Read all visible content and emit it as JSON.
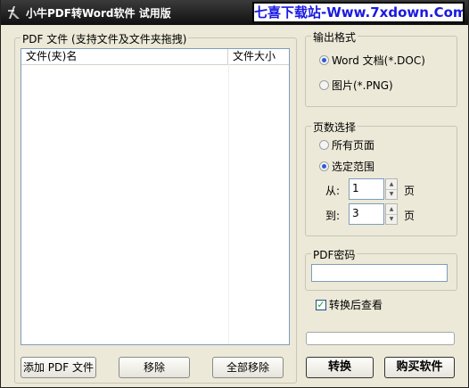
{
  "window": {
    "title": "小牛PDF转Word软件 试用版",
    "watermark": "七喜下载站-Www.7xdown.Com"
  },
  "file_group": {
    "label": "PDF 文件 (支持文件及文件夹拖拽)",
    "columns": [
      "文件(夹)名",
      "文件大小"
    ],
    "rows": []
  },
  "buttons": {
    "add_pdf": "添加 PDF 文件",
    "remove": "移除",
    "remove_all": "全部移除",
    "convert": "转换",
    "buy": "购买软件"
  },
  "output_format": {
    "label": "输出格式",
    "options": [
      "Word 文档(*.DOC)",
      "图片(*.PNG)"
    ],
    "selected": "Word 文档(*.DOC)"
  },
  "page_select": {
    "label": "页数选择",
    "options": [
      "所有页面",
      "选定范围"
    ],
    "selected": "选定范围",
    "from_label": "从:",
    "from_value": "1",
    "to_label": "到:",
    "to_value": "3",
    "unit": "页"
  },
  "pdf_password": {
    "label": "PDF密码",
    "value": ""
  },
  "view_after": {
    "label": "转换后查看",
    "checked": true
  },
  "progress": {
    "value": 0
  }
}
